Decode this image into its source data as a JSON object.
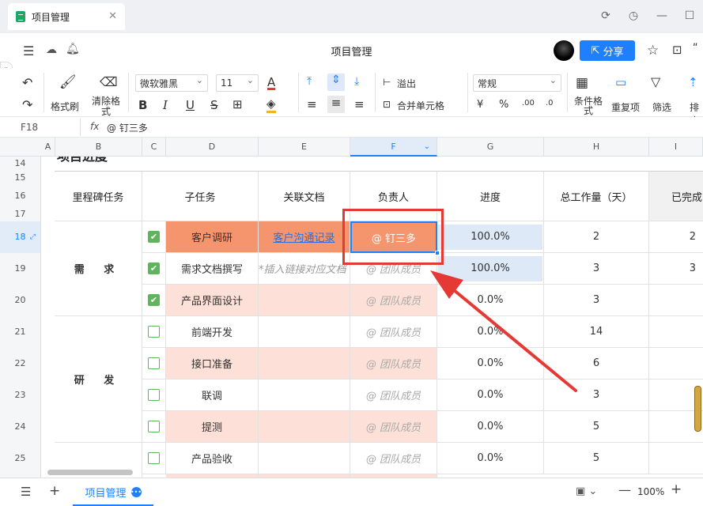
{
  "window": {
    "tab_title": "项目管理",
    "doc_title": "项目管理",
    "share_label": "分享"
  },
  "toolbar": {
    "format_painter": "格式刷",
    "clear_format": "清除格式",
    "font_name": "微软雅黑",
    "font_size": "11",
    "overflow": "溢出",
    "merge": "合并单元格",
    "number_format": "常规",
    "cond_format": "条件格式",
    "dup": "重复项",
    "filter": "筛选",
    "sort": "排序"
  },
  "formula": {
    "cell_ref": "F18",
    "fx": "fx",
    "content": "@ 钉三多"
  },
  "columns": [
    "A",
    "B",
    "C",
    "D",
    "E",
    "F",
    "G",
    "H",
    "I"
  ],
  "rows": [
    "14",
    "15",
    "16",
    "17",
    "18",
    "19",
    "20",
    "21",
    "22",
    "23",
    "24",
    "25"
  ],
  "section_title": "项目进度",
  "headers": {
    "milestone": "里程碑任务",
    "subtask": "子任务",
    "doc": "关联文档",
    "owner": "负责人",
    "progress": "进度",
    "workload": "总工作量（天）",
    "done": "已完成"
  },
  "milestones": [
    "需 求",
    "研 发"
  ],
  "tasks": [
    {
      "checked": true,
      "name": "客户调研",
      "doc": "客户沟通记录",
      "owner": "@ 钉三多",
      "progress": "100.0%",
      "workload": "2",
      "done": "2"
    },
    {
      "checked": true,
      "name": "需求文档撰写",
      "doc": "*插入链接对应文档",
      "owner": "@ 团队成员",
      "progress": "100.0%",
      "workload": "3",
      "done": "3"
    },
    {
      "checked": true,
      "name": "产品界面设计",
      "doc": "",
      "owner": "@ 团队成员",
      "progress": "0.0%",
      "workload": "3",
      "done": ""
    },
    {
      "checked": false,
      "name": "前端开发",
      "doc": "",
      "owner": "@ 团队成员",
      "progress": "0.0%",
      "workload": "14",
      "done": ""
    },
    {
      "checked": false,
      "name": "接口准备",
      "doc": "",
      "owner": "@ 团队成员",
      "progress": "0.0%",
      "workload": "6",
      "done": ""
    },
    {
      "checked": false,
      "name": "联调",
      "doc": "",
      "owner": "@ 团队成员",
      "progress": "0.0%",
      "workload": "3",
      "done": ""
    },
    {
      "checked": false,
      "name": "提测",
      "doc": "",
      "owner": "@ 团队成员",
      "progress": "0.0%",
      "workload": "5",
      "done": ""
    },
    {
      "checked": false,
      "name": "产品验收",
      "doc": "",
      "owner": "@ 团队成员",
      "progress": "0.0%",
      "workload": "5",
      "done": ""
    }
  ],
  "bottom": {
    "sheet_name": "项目管理",
    "zoom": "100%"
  },
  "colors": {
    "accent": "#1e80ff",
    "orange": "#f5956d",
    "pink": "#fde0d7",
    "blue_cell": "#dde9f7",
    "highlight": "#e53935",
    "check": "#5fb65a"
  }
}
